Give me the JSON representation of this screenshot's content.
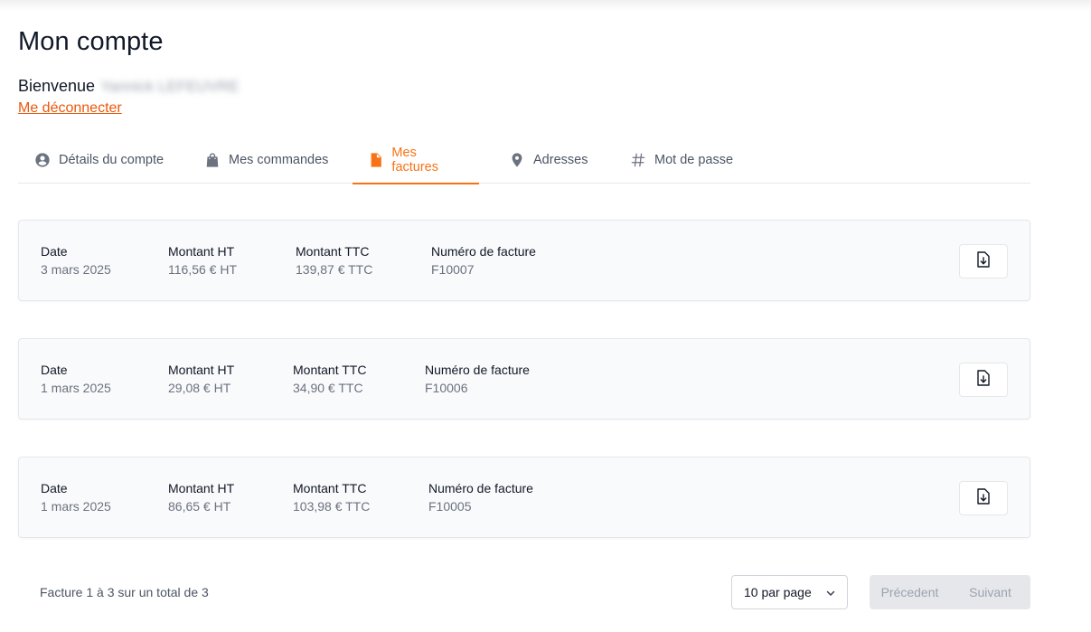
{
  "page": {
    "title": "Mon compte"
  },
  "welcome": {
    "label": "Bienvenue",
    "name": "Yannick LEFEUVRE"
  },
  "logout_label": "Me déconnecter",
  "tabs": [
    {
      "label": "Détails du compte",
      "icon": "user-circle-icon",
      "active": false
    },
    {
      "label": "Mes commandes",
      "icon": "shopping-bag-icon",
      "active": false
    },
    {
      "label": "Mes factures",
      "icon": "document-icon",
      "active": true
    },
    {
      "label": "Adresses",
      "icon": "map-pin-icon",
      "active": false
    },
    {
      "label": "Mot de passe",
      "icon": "hashtag-icon",
      "active": false
    }
  ],
  "invoices": [
    {
      "date_label": "Date",
      "date": "3 mars 2025",
      "ht_label": "Montant HT",
      "ht": "116,56 € HT",
      "ttc_label": "Montant TTC",
      "ttc": "139,87 € TTC",
      "num_label": "Numéro de facture",
      "num": "F10007",
      "download_icon": "document-download-icon"
    },
    {
      "date_label": "Date",
      "date": "1 mars 2025",
      "ht_label": "Montant HT",
      "ht": "29,08 € HT",
      "ttc_label": "Montant TTC",
      "ttc": "34,90 € TTC",
      "num_label": "Numéro de facture",
      "num": "F10006",
      "download_icon": "document-download-icon"
    },
    {
      "date_label": "Date",
      "date": "1 mars 2025",
      "ht_label": "Montant HT",
      "ht": "86,65 € HT",
      "ttc_label": "Montant TTC",
      "ttc": "103,98 € TTC",
      "num_label": "Numéro de facture",
      "num": "F10005",
      "download_icon": "document-download-icon"
    }
  ],
  "footer": {
    "count_text": "Facture 1 à 3 sur un total de 3",
    "per_page": "10 par page",
    "prev_label": "Précedent",
    "next_label": "Suivant"
  },
  "colors": {
    "accent": "#f97316",
    "link": "#ea580c",
    "card_bg": "#f9fafb",
    "muted": "#6b7280"
  }
}
